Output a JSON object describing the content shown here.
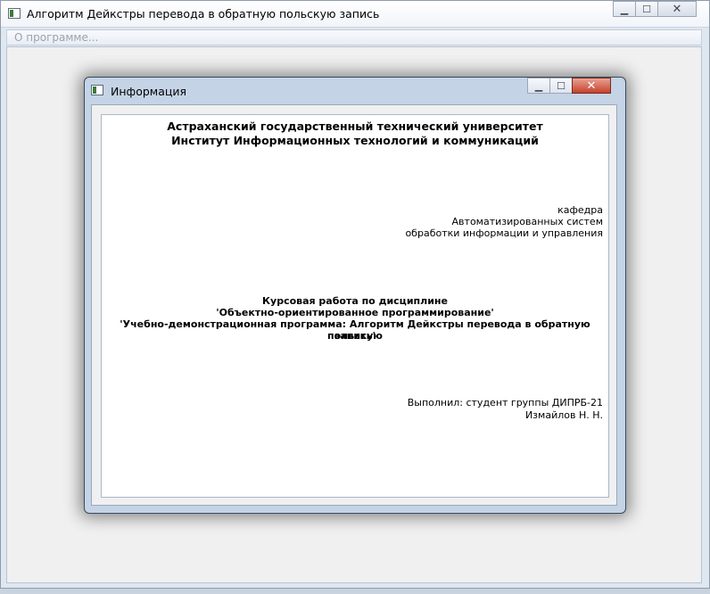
{
  "main_window": {
    "title": "Алгоритм Дейкстры перевода в обратную польскую запись",
    "menu": [
      "О программе..."
    ],
    "controls": {
      "minimize": "▁",
      "maximize": "☐",
      "close": "✕"
    }
  },
  "dialog": {
    "title": "Информация",
    "controls": {
      "minimize": "▁",
      "maximize": "☐",
      "close": "✕"
    },
    "text": {
      "university": "Астраханский государственный технический университет",
      "institute": "Институт Информационных технологий и коммуникаций",
      "dept_line1": "кафедра",
      "dept_line2": "Автоматизированных систем",
      "dept_line3": "обработки информации и управления",
      "course_line1": "Курсовая работа по дисциплине",
      "course_line2": "'Объектно-ориентированное программирование'",
      "course_line3": "'Учебно-демонстрационная программа: Алгоритм Дейкстры перевода в обратную польскую",
      "course_line4": "запись'",
      "author_line1": "Выполнил: студент группы ДИПРБ-21",
      "author_line2": "Измайлов Н. Н."
    }
  }
}
